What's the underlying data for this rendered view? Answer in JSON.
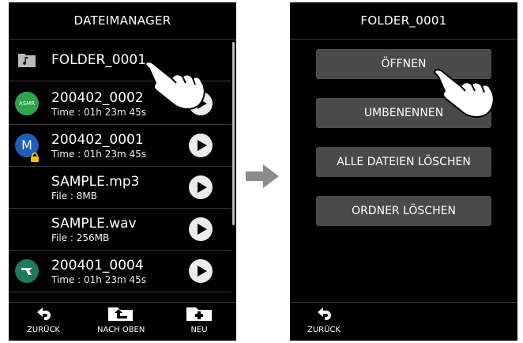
{
  "left": {
    "title": "DATEIMANAGER",
    "folder": {
      "name": "FOLDER_0001",
      "icon": "music-folder-icon"
    },
    "items": [
      {
        "name": "200402_0002",
        "sub": "Time : 01h 23m 45s",
        "badge": "ASMR",
        "badge_color": "#2ea44f"
      },
      {
        "name": "200402_0001",
        "sub": "Time : 01h 23m 45s",
        "badge": "M",
        "badge_color": "#1f5fb8"
      },
      {
        "name": "SAMPLE.mp3",
        "sub": "File : 8MB",
        "badge": ""
      },
      {
        "name": "SAMPLE.wav",
        "sub": "File : 256MB",
        "badge": ""
      },
      {
        "name": "200401_0004",
        "sub": "Time : 01h 23m 45s",
        "badge": "",
        "badge_color": "#1d7a5a"
      }
    ],
    "footer": {
      "back": "ZURÜCK",
      "up": "NACH OBEN",
      "new": "NEU"
    }
  },
  "right": {
    "title": "FOLDER_0001",
    "buttons": {
      "open": "ÖFFNEN",
      "rename": "UMBENENNEN",
      "delete_all": "ALLE DATEIEN LÖSCHEN",
      "delete_folder": "ORDNER LÖSCHEN"
    },
    "footer": {
      "back": "ZURÜCK"
    }
  },
  "colors": {
    "screen_bg": "#000000",
    "button_bg": "#4a4a4a",
    "arrow": "#8c8c8c"
  }
}
